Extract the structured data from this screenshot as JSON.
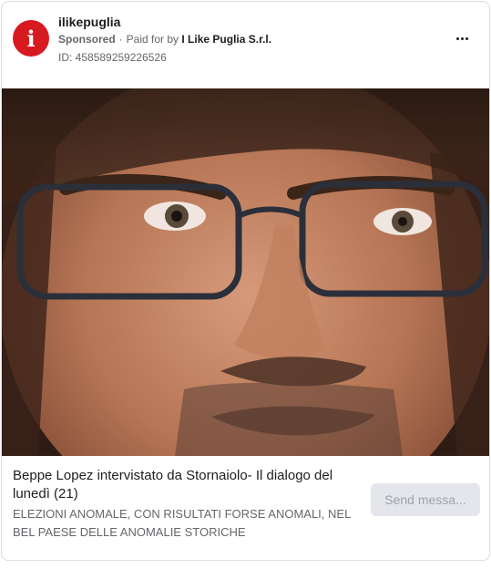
{
  "page": {
    "name": "ilikepuglia",
    "avatar_letter": "i",
    "sponsored_label": "Sponsored",
    "separator": "·",
    "paid_for_prefix": "Paid for by",
    "payer": "I Like Puglia S.r.l.",
    "ad_id": "ID: 458589259226526"
  },
  "media": {
    "icon": "photo-of-man-with-glasses"
  },
  "link": {
    "headline": "Beppe Lopez intervistato da Stornaiolo- Il dialogo del lunedì (21)",
    "description": "ELEZIONI ANOMALE, CON RISULTATI FORSE ANOMALI, NEL BEL PAESE DELLE ANOMALIE STORICHE"
  },
  "cta": {
    "label": "Send messa..."
  },
  "colors": {
    "avatar_bg": "#d71a1f",
    "secondary_text": "#65676b",
    "cta_bg": "#e4e6eb"
  }
}
